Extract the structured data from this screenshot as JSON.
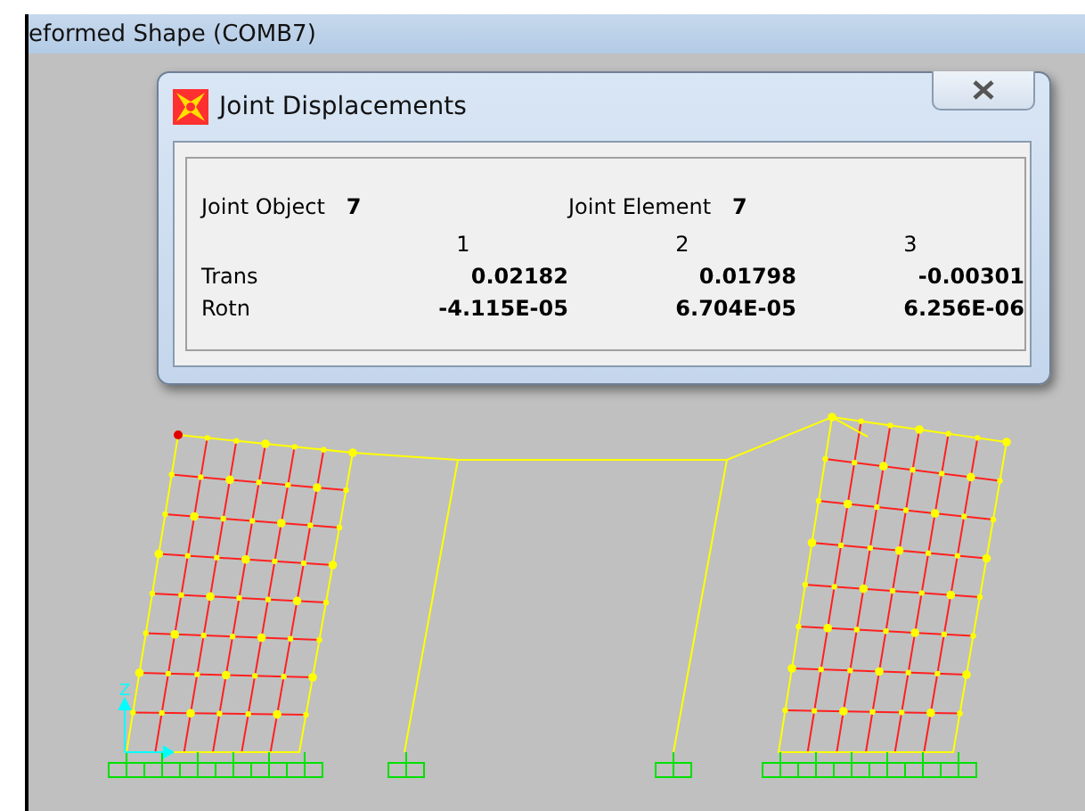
{
  "window": {
    "title": "eformed Shape (COMB7)"
  },
  "dialog": {
    "title": "Joint Displacements",
    "fields": [
      {
        "label": "Joint Object",
        "value": "7"
      },
      {
        "label": "Joint Element",
        "value": "7"
      }
    ],
    "columns": [
      "1",
      "2",
      "3"
    ],
    "rows": [
      {
        "label": "Trans",
        "values": [
          "0.02182",
          "0.01798",
          "-0.00301"
        ]
      },
      {
        "label": "Rotn",
        "values": [
          "-4.115E-05",
          "6.704E-05",
          "6.256E-06"
        ]
      }
    ]
  },
  "axis": {
    "label": "Z"
  }
}
